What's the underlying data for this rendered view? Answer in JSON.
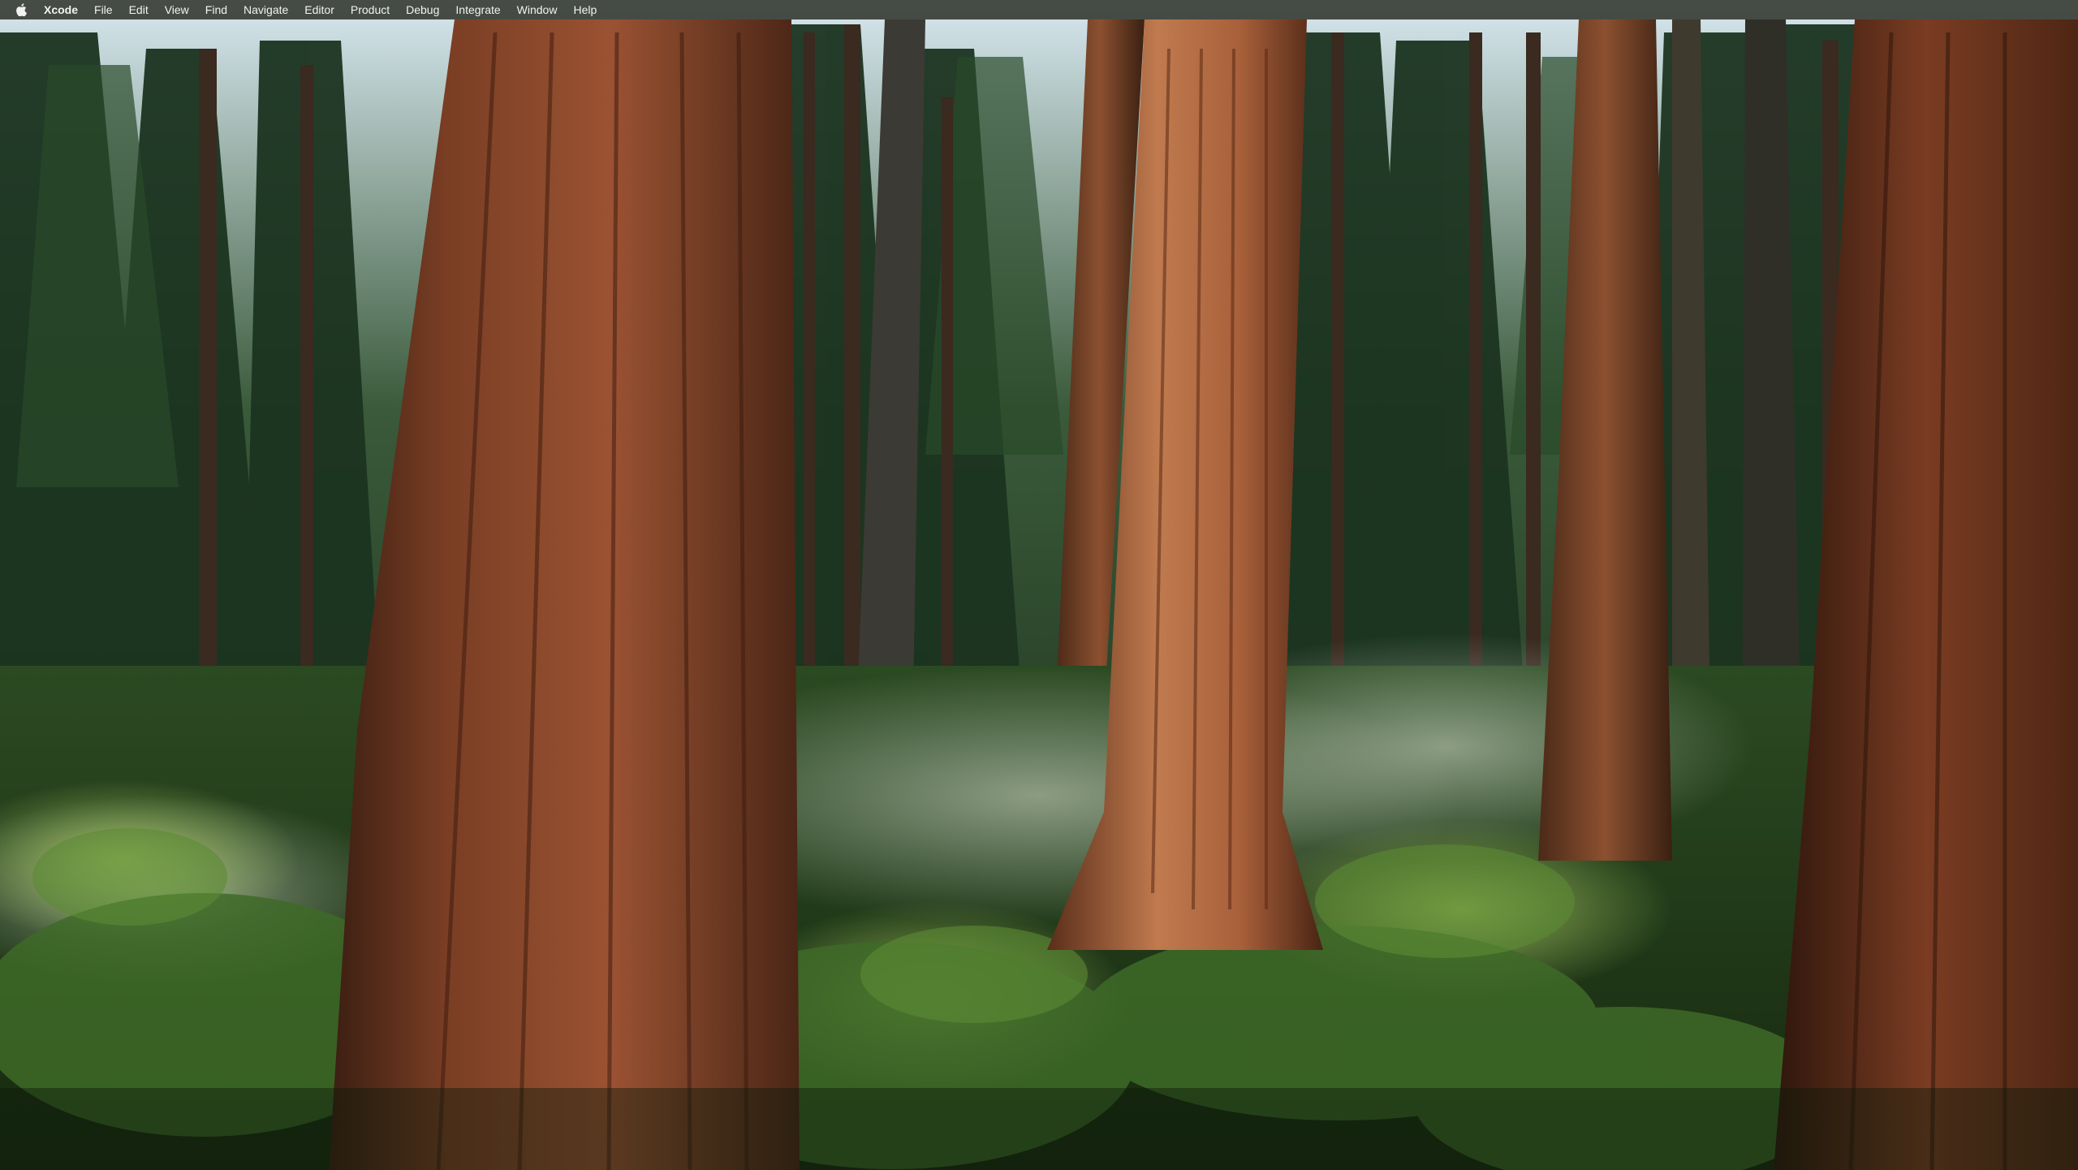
{
  "menubar": {
    "apple_icon": "apple-logo-icon",
    "app_name": "Xcode",
    "items": [
      "File",
      "Edit",
      "View",
      "Find",
      "Navigate",
      "Editor",
      "Product",
      "Debug",
      "Integrate",
      "Window",
      "Help"
    ]
  },
  "wallpaper": {
    "description_icon": "forest-wallpaper",
    "colors": {
      "sky": "#cfe3ee",
      "canopy": "#1c3a24",
      "bark": "#8a4a2c",
      "fern": "#4d7a2c",
      "mist": "#c8d2c4"
    }
  }
}
